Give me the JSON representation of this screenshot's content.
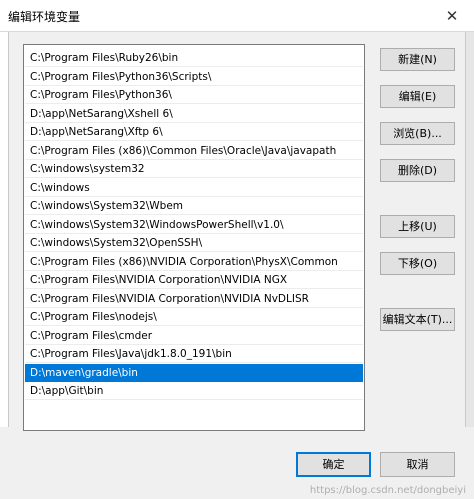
{
  "window": {
    "title": "编辑环境变量",
    "close_glyph": "✕"
  },
  "paths": [
    "C:\\Program Files\\Ruby26\\bin",
    "C:\\Program Files\\Python36\\Scripts\\",
    "C:\\Program Files\\Python36\\",
    "D:\\app\\NetSarang\\Xshell 6\\",
    "D:\\app\\NetSarang\\Xftp 6\\",
    "C:\\Program Files (x86)\\Common Files\\Oracle\\Java\\javapath",
    "C:\\windows\\system32",
    "C:\\windows",
    "C:\\windows\\System32\\Wbem",
    "C:\\windows\\System32\\WindowsPowerShell\\v1.0\\",
    "C:\\windows\\System32\\OpenSSH\\",
    "C:\\Program Files (x86)\\NVIDIA Corporation\\PhysX\\Common",
    "C:\\Program Files\\NVIDIA Corporation\\NVIDIA NGX",
    "C:\\Program Files\\NVIDIA Corporation\\NVIDIA NvDLISR",
    "C:\\Program Files\\nodejs\\",
    "C:\\Program Files\\cmder",
    "C:\\Program Files\\Java\\jdk1.8.0_191\\bin",
    "D:\\maven\\gradle\\bin",
    "D:\\app\\Git\\bin"
  ],
  "selected_index": 17,
  "buttons": {
    "new": "新建(N)",
    "edit": "编辑(E)",
    "browse": "浏览(B)...",
    "delete": "删除(D)",
    "move_up": "上移(U)",
    "move_down": "下移(O)",
    "edit_text": "编辑文本(T)...",
    "ok": "确定",
    "cancel": "取消"
  },
  "watermark": "https://blog.csdn.net/dongbeiyi"
}
